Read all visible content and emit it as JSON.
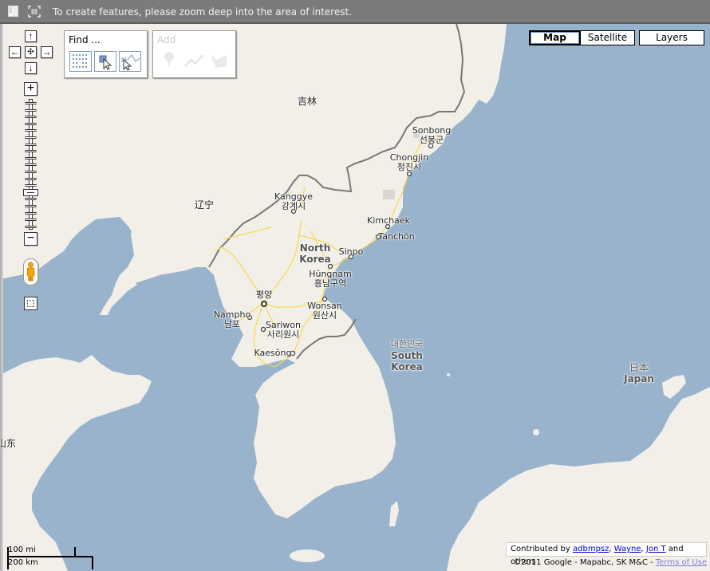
{
  "topbar": {
    "message": "To create features, please zoom deep into the area of interest.",
    "icons": [
      "sidebar-toggle-icon",
      "fullscreen-icon"
    ]
  },
  "navigation": {
    "pan": {
      "up": "↑",
      "down": "↓",
      "left": "←",
      "right": "→",
      "center": "✣"
    },
    "zoom_in": "+",
    "zoom_out": "−",
    "zoom_levels": 19,
    "zoom_level_selected": 14
  },
  "find_panel": {
    "title": "Find ...",
    "tools": [
      "grid-select-icon",
      "select-point-icon",
      "select-line-icon"
    ]
  },
  "add_panel": {
    "title": "Add",
    "tools": [
      "add-placemark-icon",
      "add-line-icon",
      "add-shape-icon"
    ]
  },
  "map_types": {
    "map": "Map",
    "satellite": "Satellite",
    "layers": "Layers",
    "selected": "Map"
  },
  "labels": {
    "provinces": [
      {
        "name": "jilin",
        "text": "吉林"
      },
      {
        "name": "liaoning",
        "text": "辽宁"
      },
      {
        "name": "shandong",
        "text": "山东"
      }
    ],
    "countries": [
      {
        "name": "north-korea",
        "line1": "North",
        "line2": "Korea"
      },
      {
        "name": "south-korea",
        "native": "대한민국",
        "line1": "South",
        "line2": "Korea"
      },
      {
        "name": "japan",
        "native": "日本",
        "line1": "Japan"
      }
    ],
    "cities": [
      {
        "name": "sonbong",
        "en": "Sonbong",
        "ko": "선봉군"
      },
      {
        "name": "chongjin",
        "en": "Chongjin",
        "ko": "청진시"
      },
      {
        "name": "kanggye",
        "en": "Kanggye",
        "ko": "강계시"
      },
      {
        "name": "kimchaek",
        "en": "Kimchaek",
        "ko": ""
      },
      {
        "name": "tanchon",
        "en": "Tanchŏn",
        "ko": ""
      },
      {
        "name": "sinpo",
        "en": "Sinpo",
        "ko": ""
      },
      {
        "name": "hungnam",
        "en": "Hŭngnam",
        "ko": "흥남구역"
      },
      {
        "name": "pyongyang",
        "en": "",
        "ko": "평양"
      },
      {
        "name": "wonsan",
        "en": "Wonsan",
        "ko": "원산시"
      },
      {
        "name": "nampho",
        "en": "Nampho",
        "ko": "남포"
      },
      {
        "name": "sariwon",
        "en": "Sariwon",
        "ko": "사리원시"
      },
      {
        "name": "kaesong",
        "en": "Kaesŏng",
        "ko": ""
      }
    ]
  },
  "scale": {
    "imperial": "100 mi",
    "metric": "200 km"
  },
  "attribution": {
    "prefix": "Contributed by",
    "contributors": [
      "adbmpsz",
      "Wayne",
      "Jon T"
    ],
    "suffix": "and others",
    "copyright": "©2011 Google - Mapabc, SK M&C -",
    "terms": "Terms of Use"
  },
  "colors": {
    "water": "#99b3cc",
    "land": "#f2efe9",
    "border": "#777777",
    "road": "#f7d94a",
    "topbar": "#7b7b7b"
  }
}
